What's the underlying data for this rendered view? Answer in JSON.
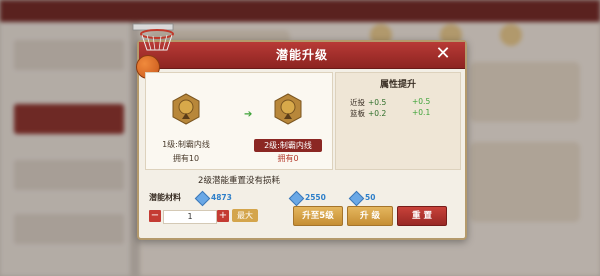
{
  "modal": {
    "title": "潜能升级",
    "close_label": "✕",
    "current_skill": {
      "level_name": "1级:制霸内线",
      "owned": "拥有10"
    },
    "next_skill": {
      "level_name": "2级:制霸内线",
      "owned": "拥有0"
    },
    "attributes": {
      "title": "属性提升",
      "rows": [
        {
          "name": "近投",
          "value": "+0.5",
          "gain": "+0.5"
        },
        {
          "name": "篮板",
          "value": "+0.2",
          "gain": "+0.1"
        }
      ]
    },
    "note": "2级潜能重置没有损耗",
    "material": {
      "label": "潜能材料",
      "amount": "4873"
    },
    "quantity": {
      "value": "1",
      "minus": "−",
      "plus": "+",
      "max_label": "最大"
    },
    "cost_upgrade_to": "2550",
    "cost_upgrade": "50",
    "buttons": {
      "upgrade_to": "升至5级",
      "upgrade": "升 级",
      "reset": "重 置"
    }
  },
  "colors": {
    "header_red": "#8d2421",
    "gold": "#d4a54c",
    "green": "#3fa33a",
    "blue": "#2e7fc9"
  }
}
